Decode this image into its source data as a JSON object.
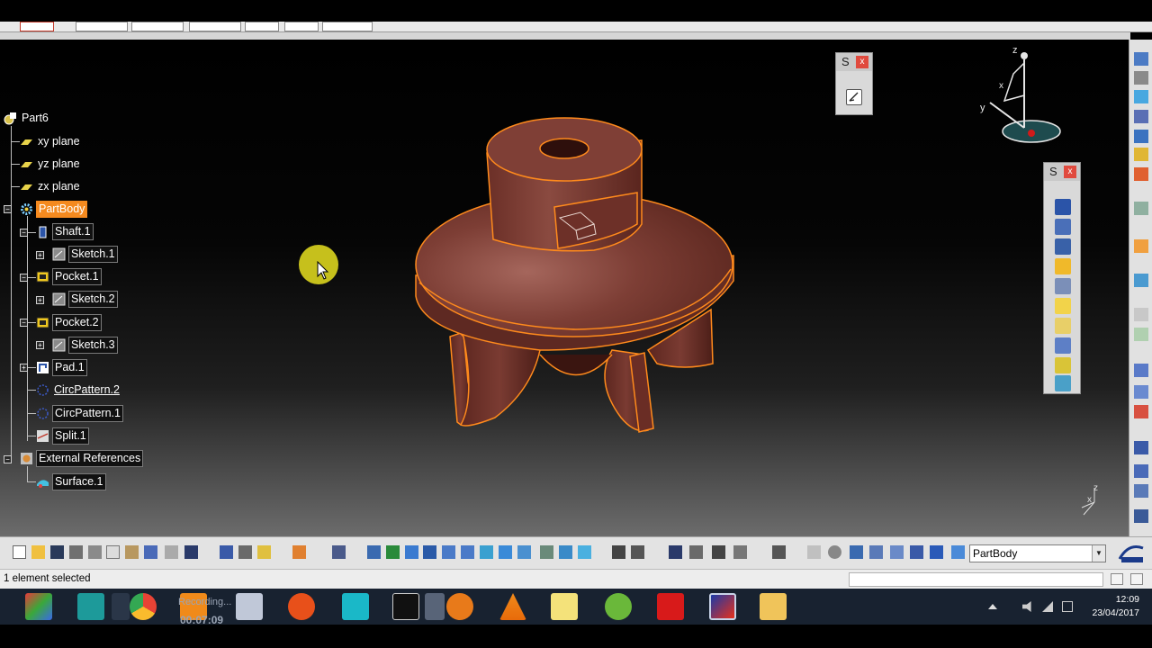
{
  "tree": {
    "root": "Part6",
    "items": [
      {
        "label": "xy plane",
        "style": "plain"
      },
      {
        "label": "yz plane",
        "style": "plain"
      },
      {
        "label": "zx plane",
        "style": "plain"
      },
      {
        "label": "PartBody",
        "style": "selected"
      },
      {
        "label": "Shaft.1",
        "style": "boxed"
      },
      {
        "label": "Sketch.1",
        "style": "boxed"
      },
      {
        "label": "Pocket.1",
        "style": "boxed"
      },
      {
        "label": "Sketch.2",
        "style": "boxed"
      },
      {
        "label": "Pocket.2",
        "style": "boxed"
      },
      {
        "label": "Sketch.3",
        "style": "boxed"
      },
      {
        "label": "Pad.1",
        "style": "boxed"
      },
      {
        "label": "CircPattern.2",
        "style": "underlined"
      },
      {
        "label": "CircPattern.1",
        "style": "boxed"
      },
      {
        "label": "Split.1",
        "style": "boxed"
      },
      {
        "label": "External References",
        "style": "boxed"
      },
      {
        "label": "Surface.1",
        "style": "boxed"
      }
    ]
  },
  "floating_toolbars": {
    "sketcher": {
      "title": "S",
      "close": "x"
    },
    "features": {
      "title": "S",
      "close": "x"
    }
  },
  "compass": {
    "z": "z",
    "y": "y",
    "x": "x"
  },
  "mini_axes": {
    "z": "z",
    "x": "x"
  },
  "bottom_toolbar": {
    "current_body": "PartBody"
  },
  "status": {
    "message": "1 element selected"
  },
  "taskbar": {
    "recording_text": "Recording...",
    "recording_time": "00:07:09",
    "time": "12:09",
    "date": "23/04/2017"
  },
  "colors": {
    "part_fill": "#7a3b32",
    "part_edge": "#ff8a1c",
    "selection": "#f58a1f",
    "cursor_highlight": "#e8e020"
  }
}
